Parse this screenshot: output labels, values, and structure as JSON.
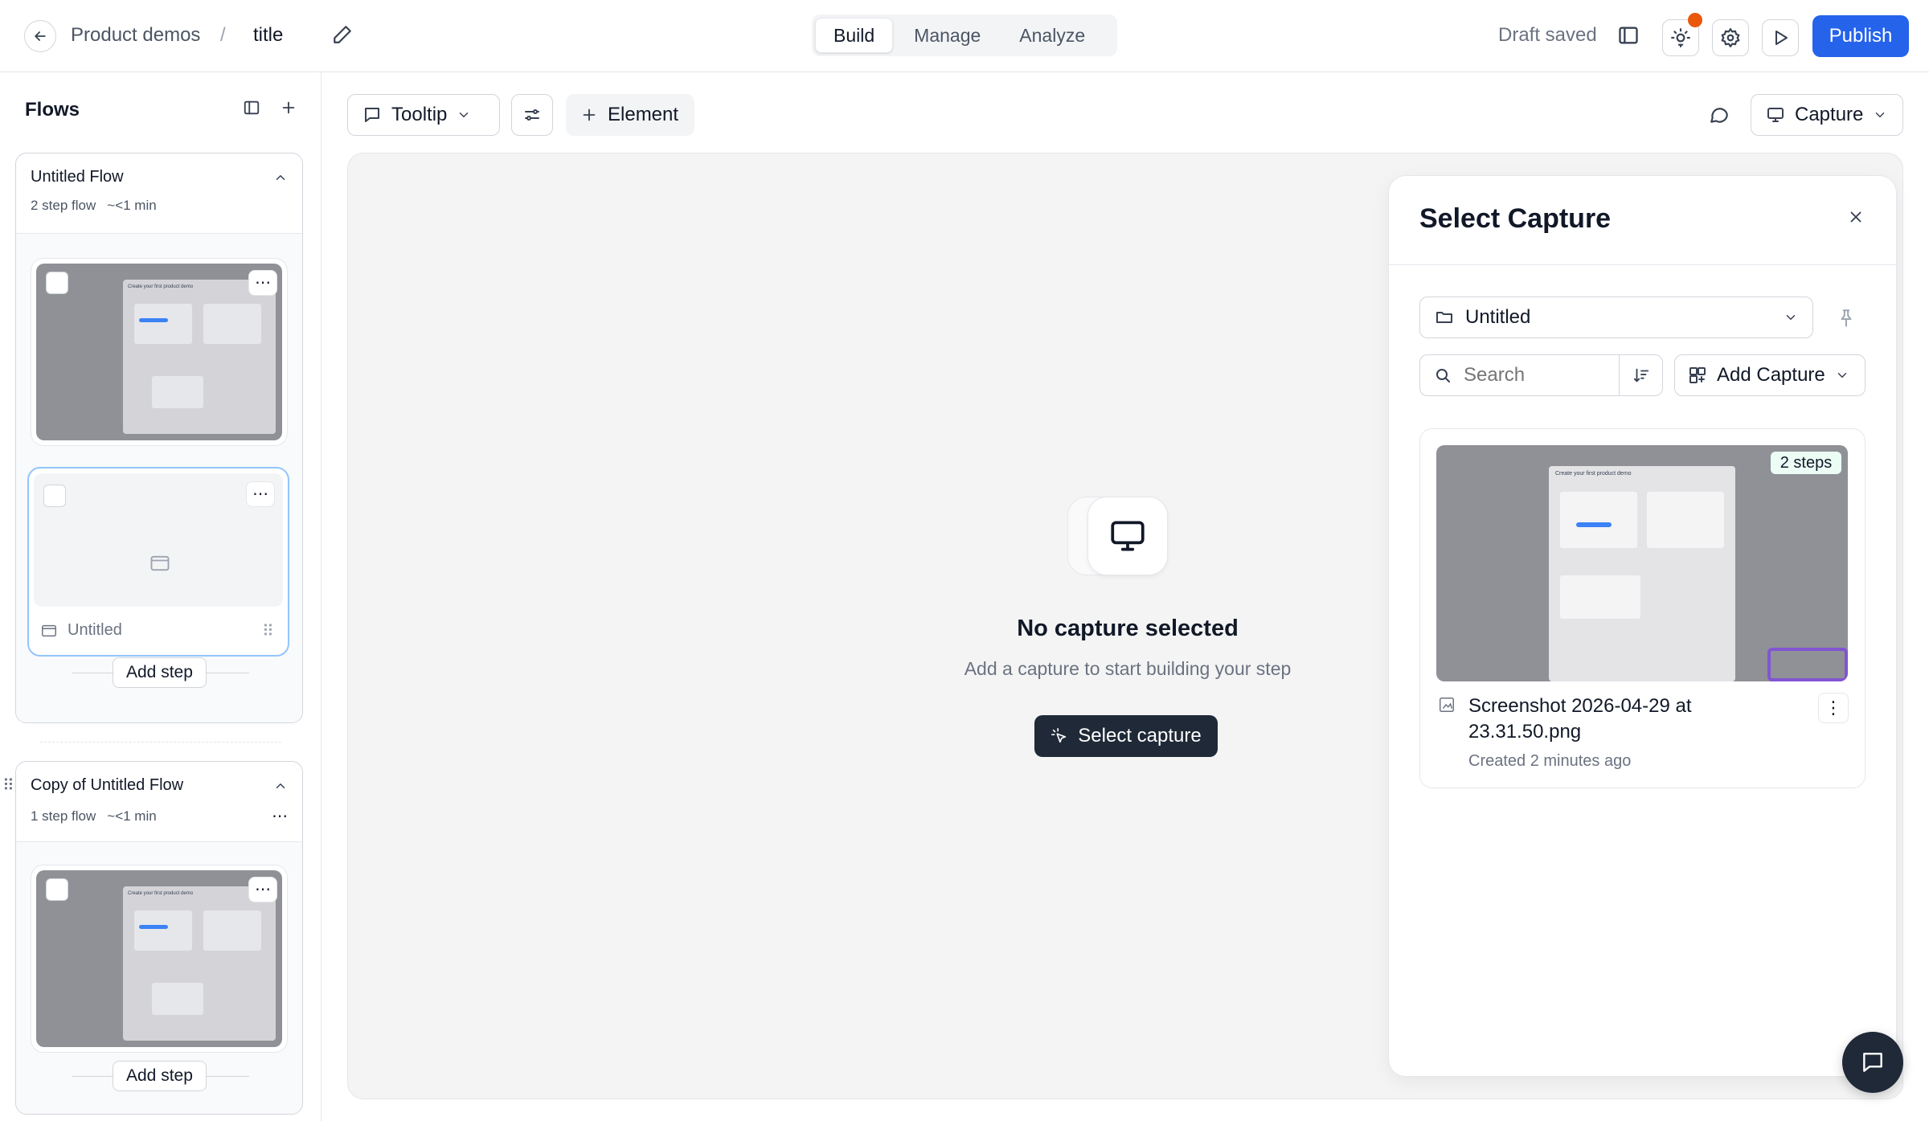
{
  "topbar": {
    "breadcrumb_parent": "Product demos",
    "separator": "/",
    "title": "title",
    "tabs": [
      {
        "label": "Build",
        "active": true
      },
      {
        "label": "Manage",
        "active": false
      },
      {
        "label": "Analyze",
        "active": false
      }
    ],
    "status": "Draft saved",
    "publish_label": "Publish"
  },
  "sidebar": {
    "title": "Flows",
    "flows": [
      {
        "name": "Untitled Flow",
        "meta_steps": "2 step flow",
        "meta_time": "~<1 min",
        "step2_label": "Untitled",
        "add_step_label": "Add step"
      },
      {
        "name": "Copy of Untitled Flow",
        "meta_steps": "1 step flow",
        "meta_time": "~<1 min",
        "add_step_label": "Add step"
      }
    ]
  },
  "toolbar": {
    "tooltip_label": "Tooltip",
    "element_label": "Element",
    "capture_label": "Capture"
  },
  "canvas": {
    "empty_title": "No capture selected",
    "empty_subtitle": "Add a capture to start building your step",
    "select_button": "Select capture"
  },
  "panel": {
    "title": "Select Capture",
    "folder_value": "Untitled",
    "search_placeholder": "Search",
    "add_capture_label": "Add Capture",
    "capture": {
      "steps_badge": "2 steps",
      "name_line1": "Screenshot 2026-04-29 at",
      "name_line2": "23.31.50.png",
      "created": "Created 2 minutes ago"
    }
  },
  "thumbnail_text": {
    "heading": "Create your first product demo"
  },
  "colors": {
    "primary": "#2563eb",
    "notification_dot": "#ea580c",
    "dark_button": "#1f2937",
    "selected_border": "#93c5fd"
  }
}
